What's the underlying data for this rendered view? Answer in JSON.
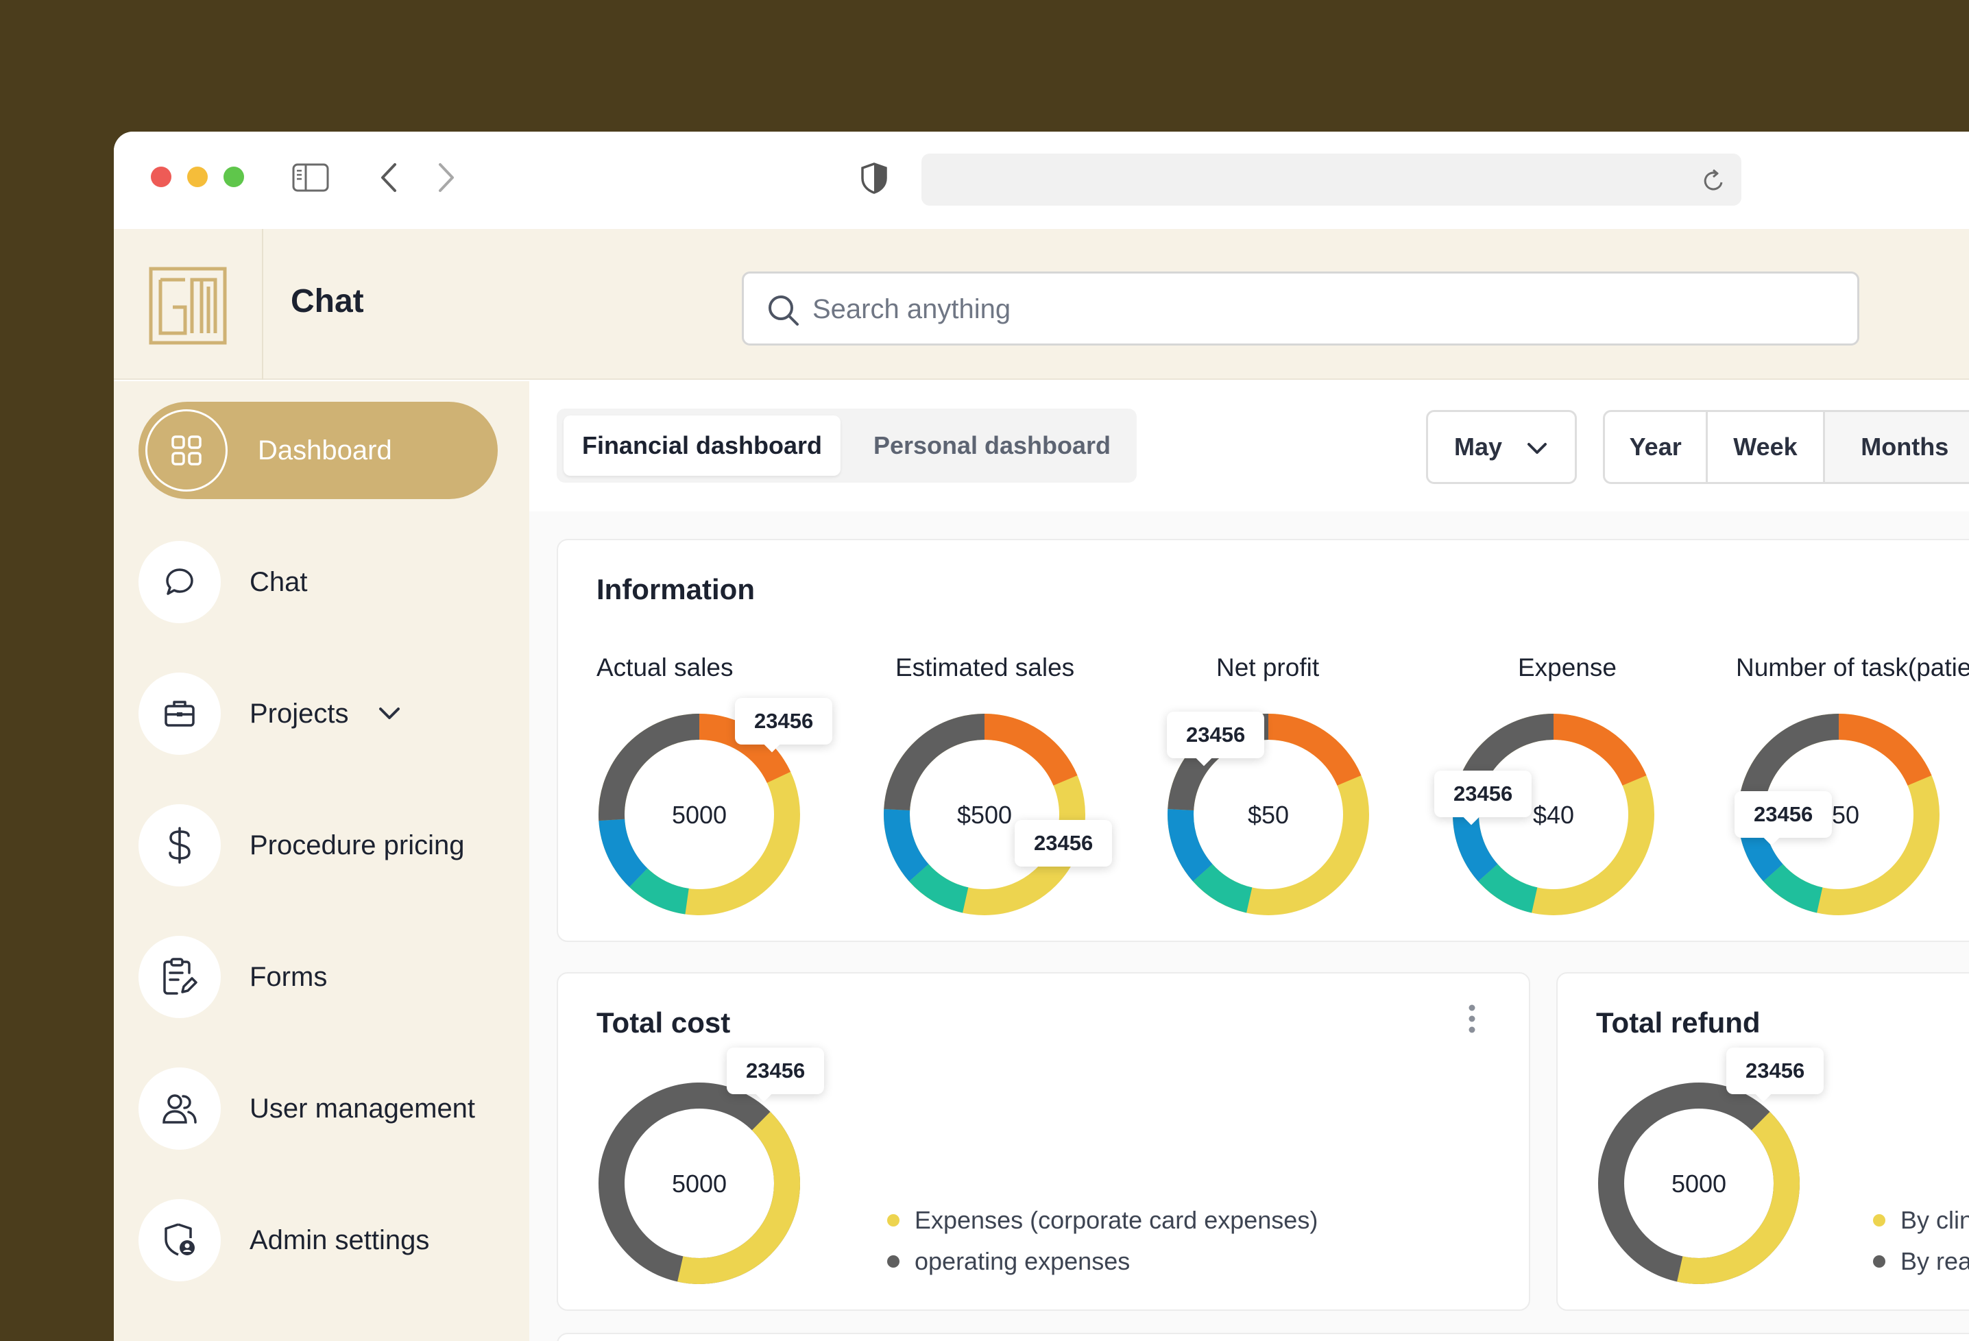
{
  "app": {
    "title": "Chat"
  },
  "search": {
    "placeholder": "Search anything"
  },
  "sidebar": {
    "items": [
      {
        "label": "Dashboard",
        "icon": "grid-icon",
        "active": true
      },
      {
        "label": "Chat",
        "icon": "chat-bubble-icon"
      },
      {
        "label": "Projects",
        "icon": "briefcase-icon"
      },
      {
        "label": "Procedure pricing",
        "icon": "dollar-icon"
      },
      {
        "label": "Forms",
        "icon": "clipboard-edit-icon"
      },
      {
        "label": "User management",
        "icon": "users-icon"
      },
      {
        "label": "Admin settings",
        "icon": "shield-user-icon"
      }
    ]
  },
  "tabs": {
    "financial": "Financial dashboard",
    "personal": "Personal dashboard"
  },
  "month_select": {
    "value": "May"
  },
  "range": {
    "year": "Year",
    "week": "Week",
    "months": "Months"
  },
  "colors": {
    "orange": "#f07522",
    "yellow": "#edd44f",
    "teal": "#1fbf9c",
    "blue": "#128fce",
    "gray": "#5f5f5f",
    "accent": "#cfb274"
  },
  "information": {
    "title": "Information",
    "metrics": [
      {
        "label": "Actual sales",
        "center": "5000",
        "tooltip": "23456"
      },
      {
        "label": "Estimated sales",
        "center": "$500",
        "tooltip": "23456"
      },
      {
        "label": "Net profit",
        "center": "$50",
        "tooltip": "23456"
      },
      {
        "label": "Expense",
        "center": "$40",
        "tooltip": "23456"
      },
      {
        "label": "Number of task(patients",
        "center": "150",
        "tooltip": "23456"
      }
    ]
  },
  "total_cost": {
    "title": "Total cost",
    "center": "5000",
    "tooltip": "23456",
    "legend": [
      "Expenses (corporate card expenses)",
      "operating expenses"
    ]
  },
  "total_refund": {
    "title": "Total refund",
    "center": "5000",
    "tooltip": "23456",
    "legend": [
      "By clin",
      "By reas"
    ]
  }
}
